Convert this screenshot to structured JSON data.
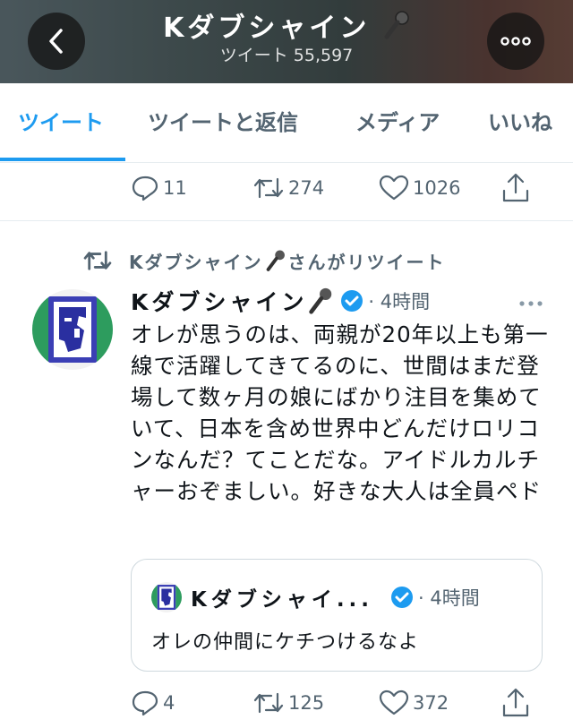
{
  "header": {
    "title": "Kダブシャイン",
    "subtitle": "ツイート 55,597",
    "back_icon": "chevron-left-icon",
    "more_icon": "more-icon",
    "title_emoji_icon": "microphone-icon"
  },
  "tabs": [
    {
      "label": "ツイート",
      "active": true
    },
    {
      "label": "ツイートと返信",
      "active": false
    },
    {
      "label": "メディア",
      "active": false
    },
    {
      "label": "いいね",
      "active": false
    }
  ],
  "prev_tweet_actions": {
    "replies": "11",
    "retweets": "274",
    "likes": "1026"
  },
  "retweet_context": "Kダブシャイン",
  "retweet_suffix": "さんがリツイート",
  "tweet": {
    "name": "Kダブシャイン",
    "time": "· 4時間",
    "verified_color": "#1d9bf0",
    "text": "オレが思うのは、両親が20年以上も第一線で活躍してきてるのに、世間はまだ登場して数ヶ月の娘にばかり注目を集めていて、日本を含め世界中どんだけロリコンなんだ？てことだな。アイドルカルチャーおぞましい。好きな大人は全員ペド",
    "quote": {
      "name": "Kダブシャイ...",
      "time": "· 4時間",
      "text": "オレの仲間にケチつけるなよ"
    },
    "actions": {
      "replies": "4",
      "retweets": "125",
      "likes": "372"
    }
  },
  "colors": {
    "accent": "#1d9bf0",
    "muted": "#536471",
    "text": "#0f1419"
  }
}
